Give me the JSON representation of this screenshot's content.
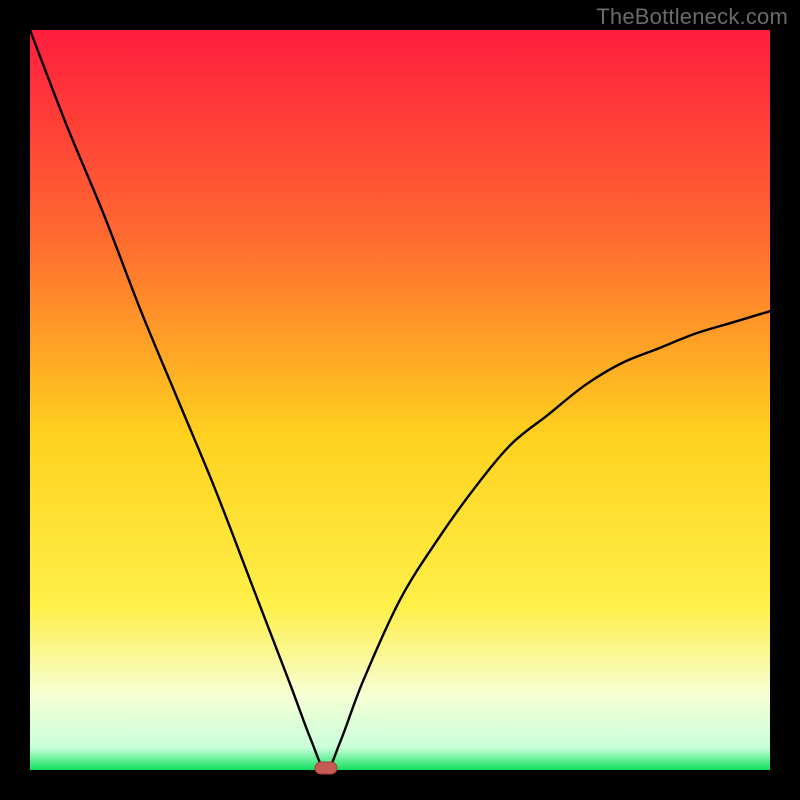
{
  "watermark": "TheBottleneck.com",
  "colors": {
    "frame": "#000000",
    "gradient_top": "#ff1d3e",
    "gradient_mid_upper": "#ff7a2f",
    "gradient_mid": "#ffd21f",
    "gradient_mid_lower": "#fff764",
    "gradient_pale": "#f6ffd6",
    "gradient_green": "#10e060",
    "curve": "#000000",
    "marker_fill": "#c65a55",
    "marker_stroke": "#a8413c"
  },
  "chart_data": {
    "type": "line",
    "title": "",
    "xlabel": "",
    "ylabel": "",
    "xlim": [
      0,
      100
    ],
    "ylim": [
      0,
      100
    ],
    "grid": false,
    "legend": false,
    "annotations": [],
    "curve_description": "V-shaped curve: steep near-linear descent from top-left to a minimum near x≈40, then a concave-up rise toward the right reaching roughly 60% height at the right edge.",
    "series": [
      {
        "name": "curve",
        "x": [
          0,
          5,
          10,
          15,
          20,
          25,
          30,
          35,
          38,
          40,
          42,
          45,
          50,
          55,
          60,
          65,
          70,
          75,
          80,
          85,
          90,
          95,
          100
        ],
        "y": [
          100,
          87,
          75,
          62,
          50,
          38,
          25,
          12,
          4,
          0,
          4,
          12,
          23,
          31,
          38,
          44,
          48,
          52,
          55,
          57,
          59,
          60.5,
          62
        ]
      }
    ],
    "marker": {
      "x": 40,
      "y": 0,
      "shape": "rounded-rect"
    }
  }
}
